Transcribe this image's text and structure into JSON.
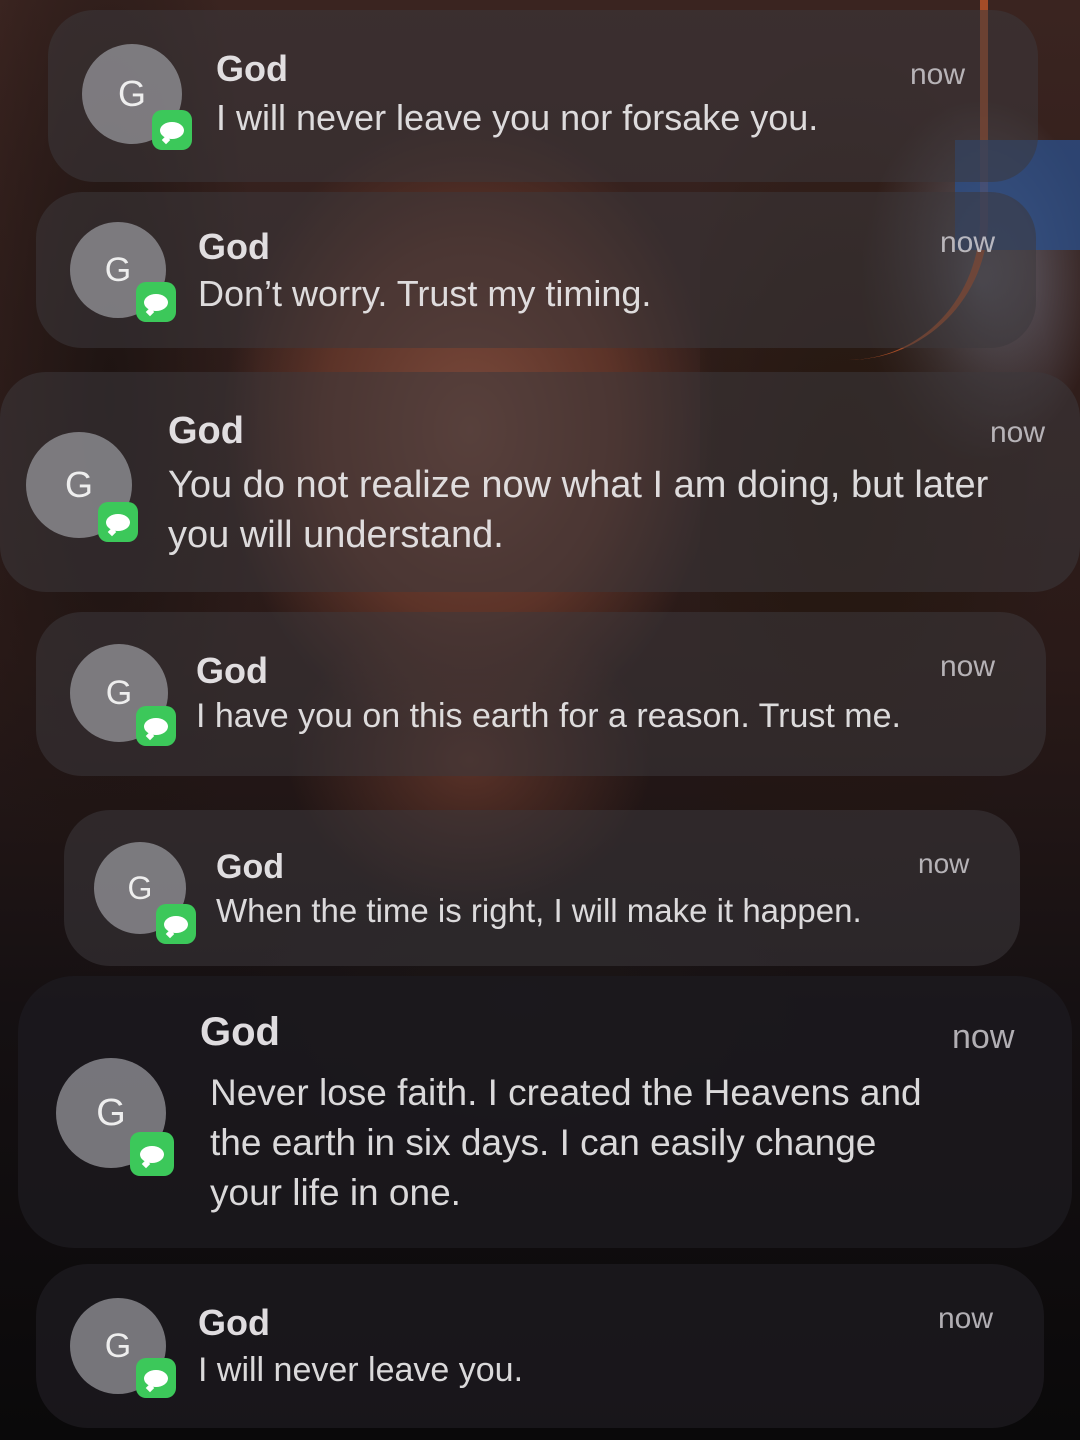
{
  "notifications": [
    {
      "avatar_letter": "G",
      "sender": "God",
      "message": "I will never leave you nor forsake you.",
      "time": "now",
      "app_icon": "messages-icon"
    },
    {
      "avatar_letter": "G",
      "sender": "God",
      "message": "Don’t worry. Trust my timing.",
      "time": "now",
      "app_icon": "messages-icon"
    },
    {
      "avatar_letter": "G",
      "sender": "God",
      "message": "You do not realize now what I am doing, but later you will understand.",
      "time": "now",
      "app_icon": "messages-icon"
    },
    {
      "avatar_letter": "G",
      "sender": "God",
      "message": "I have you on this earth for a reason. Trust me.",
      "time": "now",
      "app_icon": "messages-icon"
    },
    {
      "avatar_letter": "G",
      "sender": "God",
      "message": "When the time is right, I will make it happen.",
      "time": "now",
      "app_icon": "messages-icon"
    },
    {
      "avatar_letter": "G",
      "sender": "God",
      "message": "Never lose faith. I created the Heavens and the earth in six days. I can easily change your life in one.",
      "time": "now",
      "app_icon": "messages-icon"
    },
    {
      "avatar_letter": "G",
      "sender": "God",
      "message": "I will never leave you.",
      "time": "now",
      "app_icon": "messages-icon"
    }
  ],
  "colors": {
    "badge_green": "#3cc85a",
    "card_dark": "#1c1a1e"
  }
}
